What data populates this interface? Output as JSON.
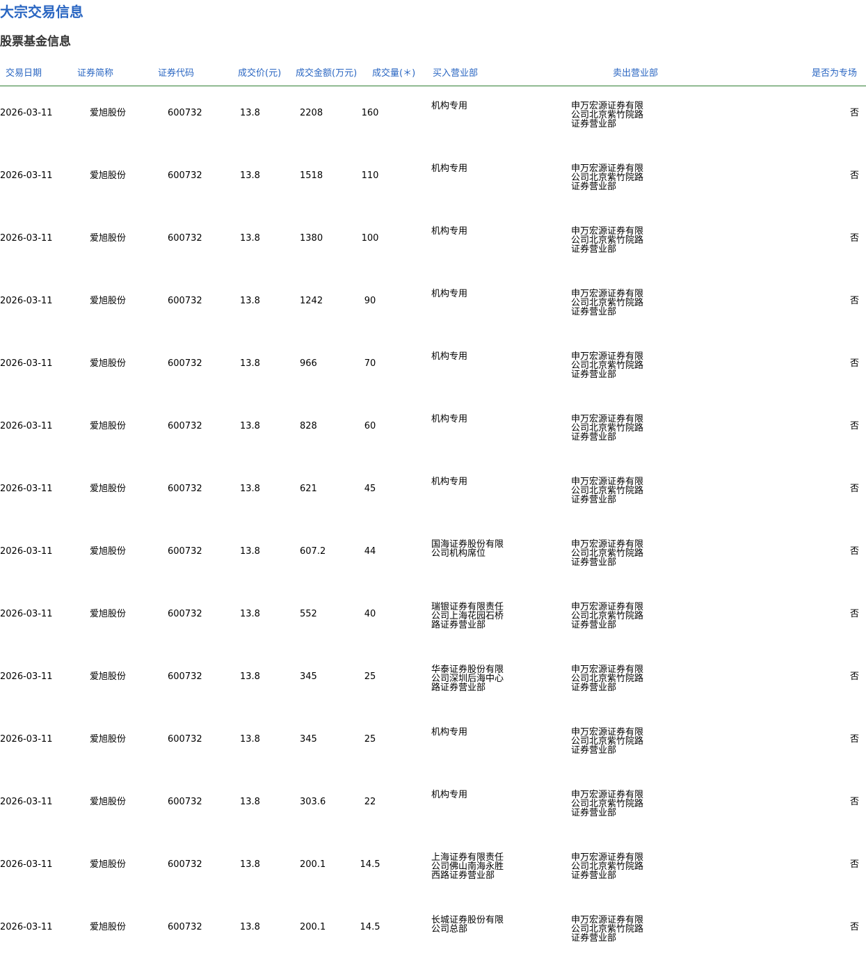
{
  "page_title": "大宗交易信息",
  "section_title": "股票基金信息",
  "columns": [
    "交易日期",
    "证券简称",
    "证券代码",
    "成交价(元)",
    "成交金额(万元)",
    "成交量(＊)",
    "买入营业部",
    "卖出营业部",
    "是否为专场"
  ],
  "rows": [
    {
      "date": "2026-03-11",
      "name": "爱旭股份",
      "code": "600732",
      "price": "13.8",
      "amount": "2208",
      "volume": "160",
      "buyer": "机构专用",
      "seller": "申万宏源证券有限公司北京紫竹院路证券营业部",
      "special": "否"
    },
    {
      "date": "2026-03-11",
      "name": "爱旭股份",
      "code": "600732",
      "price": "13.8",
      "amount": "1518",
      "volume": "110",
      "buyer": "机构专用",
      "seller": "申万宏源证券有限公司北京紫竹院路证券营业部",
      "special": "否"
    },
    {
      "date": "2026-03-11",
      "name": "爱旭股份",
      "code": "600732",
      "price": "13.8",
      "amount": "1380",
      "volume": "100",
      "buyer": "机构专用",
      "seller": "申万宏源证券有限公司北京紫竹院路证券营业部",
      "special": "否"
    },
    {
      "date": "2026-03-11",
      "name": "爱旭股份",
      "code": "600732",
      "price": "13.8",
      "amount": "1242",
      "volume": "90",
      "buyer": "机构专用",
      "seller": "申万宏源证券有限公司北京紫竹院路证券营业部",
      "special": "否"
    },
    {
      "date": "2026-03-11",
      "name": "爱旭股份",
      "code": "600732",
      "price": "13.8",
      "amount": "966",
      "volume": "70",
      "buyer": "机构专用",
      "seller": "申万宏源证券有限公司北京紫竹院路证券营业部",
      "special": "否"
    },
    {
      "date": "2026-03-11",
      "name": "爱旭股份",
      "code": "600732",
      "price": "13.8",
      "amount": "828",
      "volume": "60",
      "buyer": "机构专用",
      "seller": "申万宏源证券有限公司北京紫竹院路证券营业部",
      "special": "否"
    },
    {
      "date": "2026-03-11",
      "name": "爱旭股份",
      "code": "600732",
      "price": "13.8",
      "amount": "621",
      "volume": "45",
      "buyer": "机构专用",
      "seller": "申万宏源证券有限公司北京紫竹院路证券营业部",
      "special": "否"
    },
    {
      "date": "2026-03-11",
      "name": "爱旭股份",
      "code": "600732",
      "price": "13.8",
      "amount": "607.2",
      "volume": "44",
      "buyer": "国海证券股份有限公司机构席位",
      "seller": "申万宏源证券有限公司北京紫竹院路证券营业部",
      "special": "否"
    },
    {
      "date": "2026-03-11",
      "name": "爱旭股份",
      "code": "600732",
      "price": "13.8",
      "amount": "552",
      "volume": "40",
      "buyer": "瑞银证券有限责任公司上海花园石桥路证券营业部",
      "seller": "申万宏源证券有限公司北京紫竹院路证券营业部",
      "special": "否"
    },
    {
      "date": "2026-03-11",
      "name": "爱旭股份",
      "code": "600732",
      "price": "13.8",
      "amount": "345",
      "volume": "25",
      "buyer": "华泰证券股份有限公司深圳后海中心路证券营业部",
      "seller": "申万宏源证券有限公司北京紫竹院路证券营业部",
      "special": "否"
    },
    {
      "date": "2026-03-11",
      "name": "爱旭股份",
      "code": "600732",
      "price": "13.8",
      "amount": "345",
      "volume": "25",
      "buyer": "机构专用",
      "seller": "申万宏源证券有限公司北京紫竹院路证券营业部",
      "special": "否"
    },
    {
      "date": "2026-03-11",
      "name": "爱旭股份",
      "code": "600732",
      "price": "13.8",
      "amount": "303.6",
      "volume": "22",
      "buyer": "机构专用",
      "seller": "申万宏源证券有限公司北京紫竹院路证券营业部",
      "special": "否"
    },
    {
      "date": "2026-03-11",
      "name": "爱旭股份",
      "code": "600732",
      "price": "13.8",
      "amount": "200.1",
      "volume": "14.5",
      "buyer": "上海证券有限责任公司佛山南海永胜西路证券营业部",
      "seller": "申万宏源证券有限公司北京紫竹院路证券营业部",
      "special": "否"
    },
    {
      "date": "2026-03-11",
      "name": "爱旭股份",
      "code": "600732",
      "price": "13.8",
      "amount": "200.1",
      "volume": "14.5",
      "buyer": "长城证券股份有限公司总部",
      "seller": "申万宏源证券有限公司北京紫竹院路证券营业部",
      "special": "否"
    }
  ]
}
